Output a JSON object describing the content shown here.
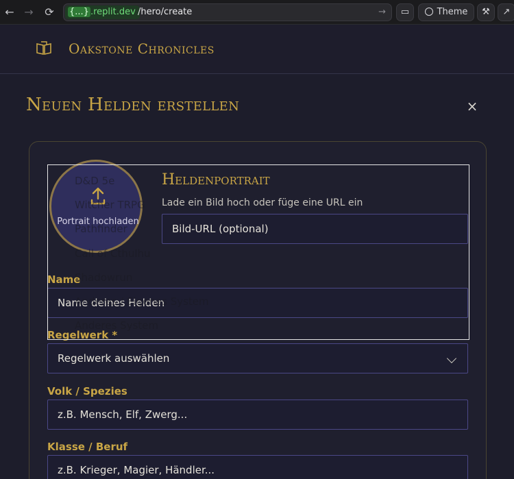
{
  "browser": {
    "host_brace": "{...}",
    "host": ".replit.dev",
    "path": "/hero/create",
    "theme_label": "Theme"
  },
  "app": {
    "brand": "Oakstone Chronicles"
  },
  "page": {
    "title": "Neuen Helden erstellen",
    "close": "×"
  },
  "portrait": {
    "upload_label": "Portrait hochladen",
    "section_title": "Heldenportrait",
    "section_subtitle": "Lade ein Bild hoch oder füge eine URL ein",
    "url_placeholder": "Bild-URL (optional)"
  },
  "form": {
    "name_label": "Name",
    "name_placeholder": "Name deines Helden",
    "ruleset_label": "Regelwerk *",
    "ruleset_value": "Regelwerk auswählen",
    "ruleset_options": [
      "D&D 5e",
      "Witcher TRPG",
      "Pathfinder",
      "Call of Cthulhu",
      "Shadowrun",
      "Anderes / Eigenes System",
      "Anderes System"
    ],
    "species_label": "Volk / Spezies",
    "species_placeholder": "z.B. Mensch, Elf, Zwerg...",
    "class_label": "Klasse / Beruf",
    "class_placeholder": "z.B. Krieger, Magier, Händler..."
  },
  "colors": {
    "accent_gold": "#c9a646",
    "field_border": "#4b4887",
    "background": "#1d1d2b"
  }
}
